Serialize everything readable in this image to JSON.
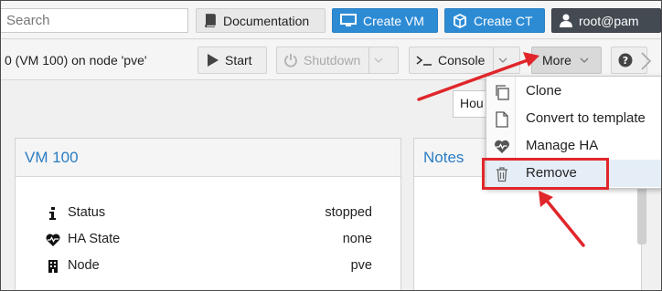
{
  "topbar": {
    "search_placeholder": "Search",
    "documentation_label": "Documentation",
    "create_vm_label": "Create VM",
    "create_ct_label": "Create CT",
    "user_label": "root@pam"
  },
  "toolbar": {
    "title": "0 (VM 100) on node 'pve'",
    "start_label": "Start",
    "shutdown_label": "Shutdown",
    "console_label": "Console",
    "more_label": "More"
  },
  "timeframe": {
    "value": "Hou"
  },
  "summary_panel": {
    "title": "VM 100",
    "rows": [
      {
        "label": "Status",
        "value": "stopped",
        "icon": "info-icon"
      },
      {
        "label": "HA State",
        "value": "none",
        "icon": "heartbeat-icon"
      },
      {
        "label": "Node",
        "value": "pve",
        "icon": "building-icon"
      }
    ]
  },
  "notes_panel": {
    "title": "Notes"
  },
  "more_menu": {
    "items": [
      {
        "label": "Clone",
        "icon": "copy-icon"
      },
      {
        "label": "Convert to template",
        "icon": "file-icon"
      },
      {
        "label": "Manage HA",
        "icon": "heartbeat-icon"
      },
      {
        "label": "Remove",
        "icon": "trash-icon"
      }
    ]
  },
  "colors": {
    "accent_blue": "#2d8bd4",
    "annotation_red": "#e0262b",
    "user_button": "#434a52"
  }
}
